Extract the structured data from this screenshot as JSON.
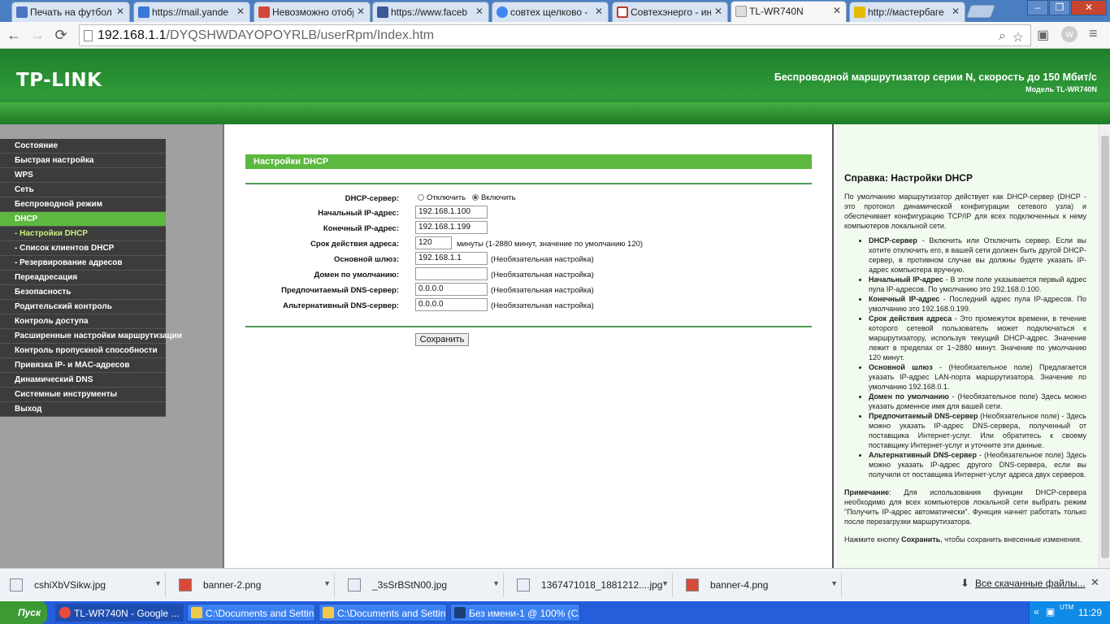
{
  "browser": {
    "tabs": [
      {
        "label": "Печать на футбол",
        "color": "#4a74c4"
      },
      {
        "label": "https://mail.yande",
        "color": "#3a78d6"
      },
      {
        "label": "Невозможно отобр",
        "color": "#d44638"
      },
      {
        "label": "https://www.faceb",
        "color": "#3b5998"
      },
      {
        "label": "совтех щелково -",
        "color": "#4285f4"
      },
      {
        "label": "Совтехэнерго - ин",
        "color": "#c0392b"
      },
      {
        "label": "TL-WR740N",
        "color": "#eeeeee"
      },
      {
        "label": "http://мастербаге",
        "color": "#e6b800"
      }
    ],
    "url_host": "192.168.1.1",
    "url_path": "/DYQSHWDAYOPOYRLB/userRpm/Index.htm",
    "window_buttons": [
      "‒",
      "❐",
      "✕"
    ]
  },
  "header": {
    "logo": "TP-LINK",
    "title": "Беспроводной маршрутизатор серии N, скорость до 150 Мбит/с",
    "model": "Модель TL-WR740N"
  },
  "menu": [
    {
      "label": "Состояние",
      "sub": false,
      "active": false
    },
    {
      "label": "Быстрая настройка",
      "sub": false,
      "active": false
    },
    {
      "label": "WPS",
      "sub": false,
      "active": false
    },
    {
      "label": "Сеть",
      "sub": false,
      "active": false
    },
    {
      "label": "Беспроводной режим",
      "sub": false,
      "active": false
    },
    {
      "label": "DHCP",
      "sub": false,
      "active": true
    },
    {
      "label": "- Настройки DHCP",
      "sub": true,
      "active": true
    },
    {
      "label": "- Список клиентов DHCP",
      "sub": true,
      "active": false
    },
    {
      "label": "- Резервирование адресов",
      "sub": true,
      "active": false
    },
    {
      "label": "Переадресация",
      "sub": false,
      "active": false
    },
    {
      "label": "Безопасность",
      "sub": false,
      "active": false
    },
    {
      "label": "Родительский контроль",
      "sub": false,
      "active": false
    },
    {
      "label": "Контроль доступа",
      "sub": false,
      "active": false
    },
    {
      "label": "Расширенные настройки маршрутизации",
      "sub": false,
      "active": false
    },
    {
      "label": "Контроль пропускной способности",
      "sub": false,
      "active": false
    },
    {
      "label": "Привязка IP- и MAC-адресов",
      "sub": false,
      "active": false
    },
    {
      "label": "Динамический DNS",
      "sub": false,
      "active": false
    },
    {
      "label": "Системные инструменты",
      "sub": false,
      "active": false
    },
    {
      "label": "Выход",
      "sub": false,
      "active": false
    }
  ],
  "form": {
    "section_title": "Настройки DHCP",
    "server_label": "DHCP-сервер:",
    "server_off": "Отключить",
    "server_on": "Включить",
    "start_ip_label": "Начальный IP-адрес:",
    "start_ip": "192.168.1.100",
    "end_ip_label": "Конечный IP-адрес:",
    "end_ip": "192.168.1.199",
    "lease_label": "Срок действия адреса:",
    "lease": "120",
    "lease_note": "минуты (1-2880 минут, значение по умолчанию 120)",
    "gateway_label": "Основной шлюз:",
    "gateway": "192.168.1.1",
    "domain_label": "Домен по умолчанию:",
    "domain": "",
    "dns1_label": "Предпочитаемый DNS-сервер:",
    "dns1": "0.0.0.0",
    "dns2_label": "Альтернативный DNS-сервер:",
    "dns2": "0.0.0.0",
    "optional_note": "(Необязательная настройка)",
    "save_label": "Сохранить"
  },
  "help": {
    "title": "Справка: Настройки DHCP",
    "intro": "По умолчанию маршрутизатор действует как DHCP-сервер (DHCP - это протокол динамической конфигурации сетевого узла) и обеспечивает конфигурацию TCP/IP для всех подключенных к нему компьютеров локальной сети.",
    "items": [
      {
        "term": "DHCP-сервер",
        "text": " - Включить или Отключить сервер. Если вы хотите отключить его, в вашей сети должен быть другой DHCP-сервер, в противном случае вы должны будете указать IP-адрес компьютера вручную."
      },
      {
        "term": "Начальный IP-адрес",
        "text": " - В этом поле указывается первый адрес пула IP-адресов. По умолчанию это 192.168.0.100."
      },
      {
        "term": "Конечный IP-адрес",
        "text": " - Последний адрес пула IP-адресов. По умолчанию это 192.168.0.199."
      },
      {
        "term": "Срок действия адреса",
        "text": " - Это промежуток времени, в течение которого сетевой пользователь может подключаться к маршрутизатору, используя текущий DHCP-адрес. Значение лежит в пределах от 1~2880 минут. Значение по умолчанию 120 минут."
      },
      {
        "term": "Основной шлюз",
        "text": " - (Необязательное поле) Предлагается указать IP-адрес LAN-порта маршрутизатора. Значение по умолчанию 192.168.0.1."
      },
      {
        "term": "Домен по умолчанию",
        "text": " - (Необязательное поле) Здесь можно указать доменное имя для вашей сети."
      },
      {
        "term": "Предпочитаемый DNS-сервер",
        "text": " (Необязательное поле) - Здесь можно указать IP-адрес DNS-сервера, полученный от поставщика Интернет-услуг. Или обратитесь к своему поставщику Интернет-услуг и уточните эти данные."
      },
      {
        "term": "Альтернативный DNS-сервер",
        "text": " - (Необязательное поле) Здесь можно указать IP-адрес другого DNS-сервера, если вы получили от поставщика Интернет-услуг адреса двух серверов."
      }
    ],
    "note_term": "Примечание",
    "note_text": ": Для использования функции DHCP-сервера необходимо для всех компьютеров локальной сети выбрать режим \"Получить IP-адрес автоматически\". Функция начнет работать только после перезагрузки маршрутизатора.",
    "save_hint_pre": "Нажмите кнопку ",
    "save_hint_term": "Сохранить",
    "save_hint_post": ", чтобы сохранить внесенные изменения."
  },
  "downloads": {
    "files": [
      "cshiXbVSikw.jpg",
      "banner-2.png",
      "_3sSrBStN00.jpg",
      "1367471018_1881212....jpg",
      "banner-4.png"
    ],
    "all_label": "Все скачанные файлы..."
  },
  "taskbar": {
    "start": "Пуск",
    "items": [
      "TL-WR740N - Google ...",
      "C:\\Documents and Settin...",
      "C:\\Documents and Settin...",
      "Без имени-1 @ 100% (С..."
    ],
    "tray_label": "UTM",
    "clock": "11:29"
  }
}
